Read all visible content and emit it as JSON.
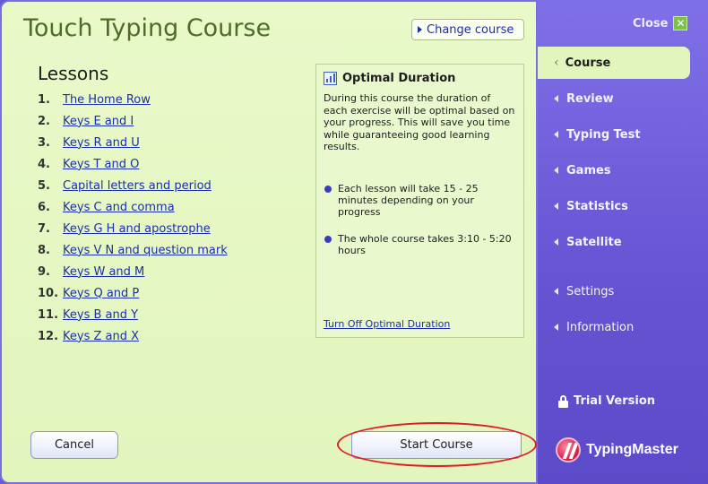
{
  "window": {
    "title": "Touch Typing Course"
  },
  "header": {
    "change_course_label": "Change course",
    "close_label": "Close",
    "close_glyph": "✕"
  },
  "lessons": {
    "heading": "Lessons",
    "items": [
      {
        "num": "1.",
        "label": "The Home Row"
      },
      {
        "num": "2.",
        "label": "Keys E and I"
      },
      {
        "num": "3.",
        "label": "Keys R and U"
      },
      {
        "num": "4.",
        "label": "Keys T and O"
      },
      {
        "num": "5.",
        "label": "Capital letters and period"
      },
      {
        "num": "6.",
        "label": "Keys C and comma"
      },
      {
        "num": "7.",
        "label": "Keys G H and apostrophe"
      },
      {
        "num": "8.",
        "label": "Keys V N and question mark"
      },
      {
        "num": "9.",
        "label": "Keys W and M"
      },
      {
        "num": "10.",
        "label": "Keys Q and P"
      },
      {
        "num": "11.",
        "label": "Keys B and Y"
      },
      {
        "num": "12.",
        "label": "Keys Z and X"
      }
    ]
  },
  "optimal": {
    "title": "Optimal Duration",
    "description": "During this course the duration of each exercise will be optimal based on your progress. This will save you time while guaranteeing good learning results.",
    "bullets": [
      "Each lesson will take 15 - 25 minutes depending on your progress",
      "The whole course takes 3:10 - 5:20 hours"
    ],
    "turn_off_label": "Turn Off Optimal Duration"
  },
  "buttons": {
    "cancel_label": "Cancel",
    "start_label": "Start Course"
  },
  "sidebar": {
    "items": [
      {
        "label": "Course",
        "active": true
      },
      {
        "label": "Review"
      },
      {
        "label": "Typing Test"
      },
      {
        "label": "Games"
      },
      {
        "label": "Statistics"
      },
      {
        "label": "Satellite"
      },
      {
        "label": "Settings"
      },
      {
        "label": "Information"
      }
    ],
    "trial_label": "Trial Version",
    "brand": "TypingMaster"
  },
  "colors": {
    "accent": "#6a5ad0",
    "panel": "#e2f5bd",
    "highlight": "#e01c24"
  }
}
